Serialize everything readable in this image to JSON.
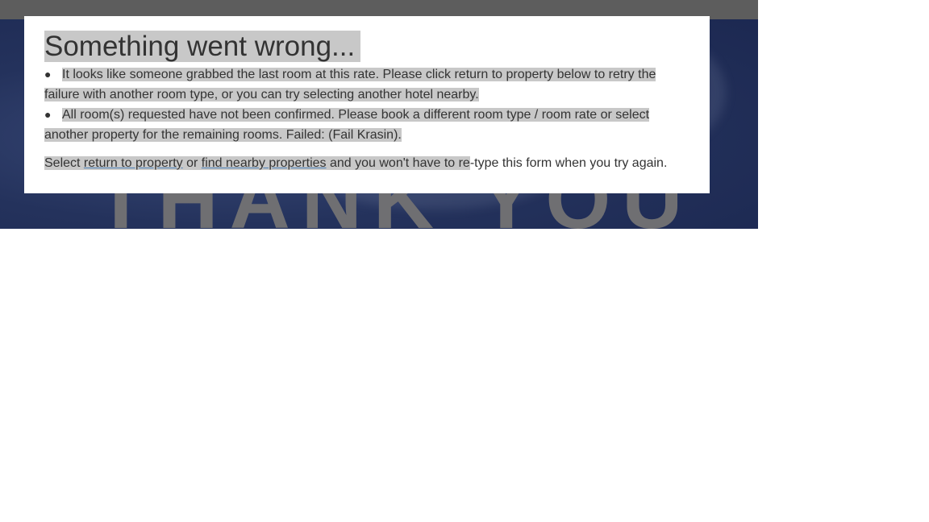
{
  "hero": {
    "text": "THANK YOU"
  },
  "dialog": {
    "title": "Something went wrong...",
    "errors": [
      "It looks like someone grabbed the last room at this rate. Please click return to property below to retry the failure with another room type, or you can try selecting another hotel nearby.",
      "All room(s) requested have not been confirmed. Please book a different room type / room rate or select another property for the remaining rooms. Failed: (Fail Krasin)."
    ],
    "footer": {
      "prefix": "Select ",
      "link_return": "return to property",
      "middle": " or ",
      "link_nearby": "find nearby properties",
      "suffix_highlighted": " and you won't have to re",
      "suffix_rest": "-type this form when you try again."
    }
  },
  "colors": {
    "highlight": "#c8c8c8",
    "text": "#333333",
    "link_underline": "#4a7fb5",
    "hero_background": "#24325c"
  }
}
